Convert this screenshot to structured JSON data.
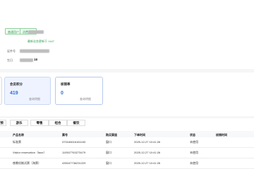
{
  "header": {
    "tags": [
      "普通用户",
      "消费用户"
    ],
    "note": "最新业务更新于 1447"
  },
  "info": {
    "card_label": "证件号",
    "country_label": "生日",
    "birthday_suffix": "18"
  },
  "stats": [
    {
      "title": "会员积分",
      "value": "419",
      "link": "查询明细"
    },
    {
      "title": "核销率",
      "value": "0",
      "link": "查询明细"
    }
  ],
  "tabs": [
    "预",
    "游乐",
    "零售",
    "组合",
    "餐饮"
  ],
  "table": {
    "columns": [
      "产品名称",
      "票号",
      "购买渠道",
      "下单时间",
      "状态",
      "核销时间"
    ],
    "rows": [
      {
        "name": "标准票",
        "ticket": "370184616161183",
        "channel": "窗口",
        "time": "2025-12-27 10:41:26",
        "status": "未使用",
        "used": ""
      },
      {
        "name": "Visitor reservation（face）",
        "ticket": "110507763273479",
        "channel": "窗口",
        "time": "2025-12-27 10:41:26",
        "status": "未使用",
        "used": ""
      },
      {
        "name": "夜晚机制试票（海票）",
        "ticket": "435167736231229",
        "channel": "窗口",
        "time": "2025-12-27 10:41:26",
        "status": "未使用",
        "used": ""
      }
    ]
  }
}
